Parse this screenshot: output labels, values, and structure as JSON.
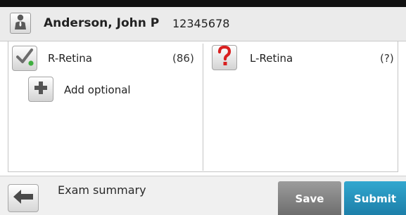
{
  "header": {
    "patient_name": "Anderson, John P",
    "patient_id": "12345678",
    "avatar_icon": "person-icon"
  },
  "right_eye": {
    "label": "R-Retina",
    "count": "(86)",
    "status_icon": "checkmark-icon",
    "status_dot_color": "#3fae3f"
  },
  "add_optional": {
    "label": "Add optional",
    "icon": "plus-icon"
  },
  "left_eye": {
    "label": "L-Retina",
    "count": "(?)",
    "status_icon": "question-mark-icon",
    "status_color": "#d92020"
  },
  "footer": {
    "back_icon": "arrow-left-icon",
    "summary_label": "Exam summary",
    "save_label": "Save",
    "submit_label": "Submit"
  },
  "colors": {
    "submit": "#2596c0",
    "save": "#858585"
  }
}
